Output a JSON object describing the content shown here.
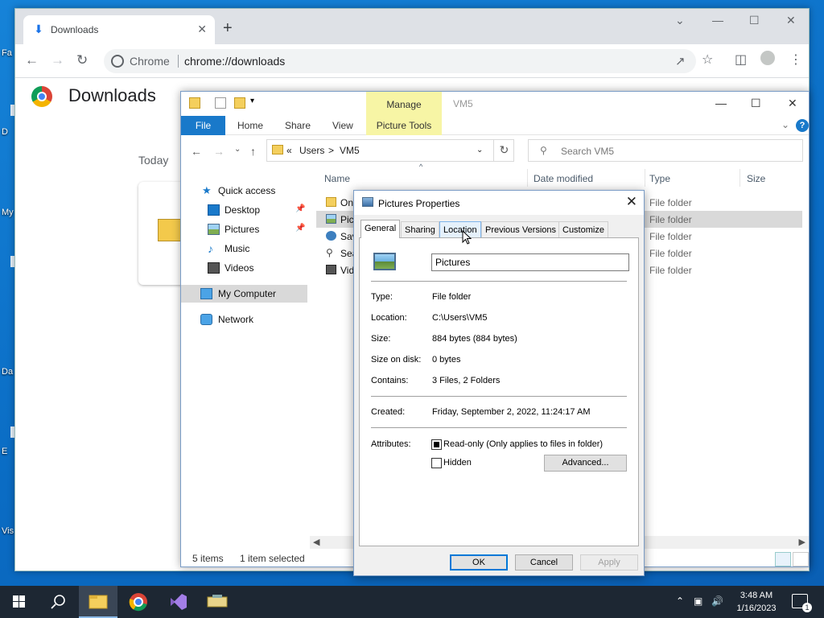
{
  "desktop": {
    "labels": [
      "Fa",
      "D",
      "My",
      "Da",
      "E",
      "Vis"
    ]
  },
  "chrome": {
    "tab_title": "Downloads",
    "omnibox_label": "Chrome",
    "url": "chrome://downloads",
    "page_title": "Downloads",
    "section_today": "Today"
  },
  "explorer": {
    "manage_label": "Manage",
    "window_name": "VM5",
    "ribbon": {
      "file": "File",
      "home": "Home",
      "share": "Share",
      "view": "View",
      "picture_tools": "Picture Tools"
    },
    "address": {
      "chevron": "«",
      "part1": "Users",
      "separator": ">",
      "part2": "VM5"
    },
    "search_placeholder": "Search VM5",
    "nav": [
      {
        "label": "Quick access",
        "icon": "star-icon"
      },
      {
        "label": "Desktop",
        "icon": "desktop-icon"
      },
      {
        "label": "Pictures",
        "icon": "pictures-icon"
      },
      {
        "label": "Music",
        "icon": "music-icon"
      },
      {
        "label": "Videos",
        "icon": "videos-icon"
      },
      {
        "label": "My Computer",
        "icon": "computer-icon"
      },
      {
        "label": "Network",
        "icon": "network-icon"
      }
    ],
    "columns": {
      "name": "Name",
      "date": "Date modified",
      "type": "Type",
      "size": "Size"
    },
    "rows": [
      {
        "name": "On",
        "type": "File folder"
      },
      {
        "name": "Pic",
        "type": "File folder"
      },
      {
        "name": "Sav",
        "type": "File folder"
      },
      {
        "name": "Sea",
        "type": "File folder"
      },
      {
        "name": "Vid",
        "type": "File folder"
      }
    ],
    "status": {
      "items": "5 items",
      "selected": "1 item selected"
    }
  },
  "dialog": {
    "title": "Pictures Properties",
    "tabs": [
      "General",
      "Sharing",
      "Location",
      "Previous Versions",
      "Customize"
    ],
    "name_value": "Pictures",
    "props": {
      "type_label": "Type:",
      "type_value": "File folder",
      "location_label": "Location:",
      "location_value": "C:\\Users\\VM5",
      "size_label": "Size:",
      "size_value": "884 bytes (884 bytes)",
      "sizeondisk_label": "Size on disk:",
      "sizeondisk_value": "0 bytes",
      "contains_label": "Contains:",
      "contains_value": "3 Files, 2 Folders",
      "created_label": "Created:",
      "created_value": "Friday, September 2, 2022, 11:24:17 AM",
      "attributes_label": "Attributes:",
      "readonly_label": "Read-only (Only applies to files in folder)",
      "hidden_label": "Hidden",
      "advanced_button": "Advanced..."
    },
    "buttons": {
      "ok": "OK",
      "cancel": "Cancel",
      "apply": "Apply"
    }
  },
  "taskbar": {
    "time": "3:48 AM",
    "date": "1/16/2023",
    "notification_count": "1"
  },
  "colors": {
    "accent": "#1979ca",
    "manage": "#f7f5a5",
    "taskbar": "#1d2733"
  }
}
